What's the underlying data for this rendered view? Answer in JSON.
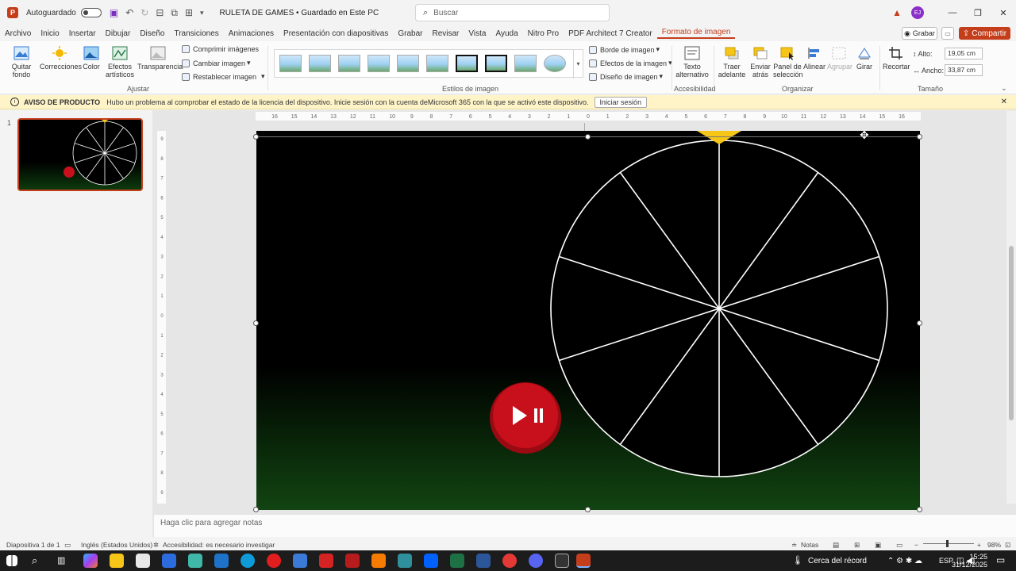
{
  "app": {
    "autosave_label": "Autoguardado",
    "doc_title": "RULETA DE GAMES • Guardado en Este PC",
    "search_placeholder": "Buscar",
    "avatar_initials": "EJ"
  },
  "menu": [
    "Archivo",
    "Inicio",
    "Insertar",
    "Dibujar",
    "Diseño",
    "Transiciones",
    "Animaciones",
    "Presentación con diapositivas",
    "Grabar",
    "Revisar",
    "Vista",
    "Ayuda",
    "Nitro Pro",
    "PDF Architect 7 Creator",
    "Formato de imagen"
  ],
  "menu_active": "Formato de imagen",
  "header_buttons": {
    "grabar": "Grabar",
    "share": "Compartir"
  },
  "ribbon": {
    "quitar_fondo": [
      "Quitar",
      "fondo"
    ],
    "correcciones": "Correcciones",
    "color": "Color",
    "efectos_artisticos": [
      "Efectos",
      "artísticos"
    ],
    "transparencia": "Transparencia",
    "comprimir": "Comprimir imágenes",
    "cambiar": "Cambiar imagen",
    "restablecer": "Restablecer imagen",
    "group_ajustar": "Ajustar",
    "group_estilos": "Estilos de imagen",
    "borde": "Borde de imagen",
    "efectos": "Efectos de la imagen",
    "diseno": "Diseño de imagen",
    "texto_alt": [
      "Texto",
      "alternativo"
    ],
    "group_accesibilidad": "Accesibilidad",
    "traer": [
      "Traer",
      "adelante"
    ],
    "enviar": [
      "Enviar",
      "atrás"
    ],
    "panel": [
      "Panel de",
      "selección"
    ],
    "alinear": "Alinear",
    "agrupar": "Agrupar",
    "girar": "Girar",
    "group_organizar": "Organizar",
    "recortar": "Recortar",
    "alto_label": "Alto:",
    "alto_value": "19,05 cm",
    "ancho_label": "Ancho:",
    "ancho_value": "33,87 cm",
    "group_tamano": "Tamaño"
  },
  "notice": {
    "title": "AVISO DE PRODUCTO",
    "message": "Hubo un problema al comprobar el estado de la licencia del dispositivo. Inicie sesión con la cuenta deMicrosoft 365 con la que se activó este dispositivo.",
    "button": "Iniciar sesión"
  },
  "slides": {
    "current_number": "1"
  },
  "ruler": {
    "top_ticks": [
      "16",
      "15",
      "14",
      "13",
      "12",
      "11",
      "10",
      "9",
      "8",
      "7",
      "6",
      "5",
      "4",
      "3",
      "2",
      "1",
      "0",
      "1",
      "2",
      "3",
      "4",
      "5",
      "6",
      "7",
      "8",
      "9",
      "10",
      "11",
      "12",
      "13",
      "14",
      "15",
      "16"
    ],
    "left_ticks": [
      "9",
      "8",
      "7",
      "6",
      "5",
      "4",
      "3",
      "2",
      "1",
      "0",
      "1",
      "2",
      "3",
      "4",
      "5",
      "6",
      "7",
      "8",
      "9"
    ]
  },
  "slide_content": {
    "wheel_segments": 10,
    "pointer_color": "#f5c518",
    "play_button_color": "#c8101c"
  },
  "notes_placeholder": "Haga clic para agregar notas",
  "status": {
    "slide_info": "Diapositiva 1 de 1",
    "language": "Inglés (Estados Unidos)",
    "accessibility": "Accesibilidad: es necesario investigar",
    "notes": "Notas",
    "zoom": "98%"
  },
  "taskbar": {
    "weather": "Cerca del récord",
    "lang": "ESP",
    "time": "15:25",
    "date": "31/12/2025"
  }
}
